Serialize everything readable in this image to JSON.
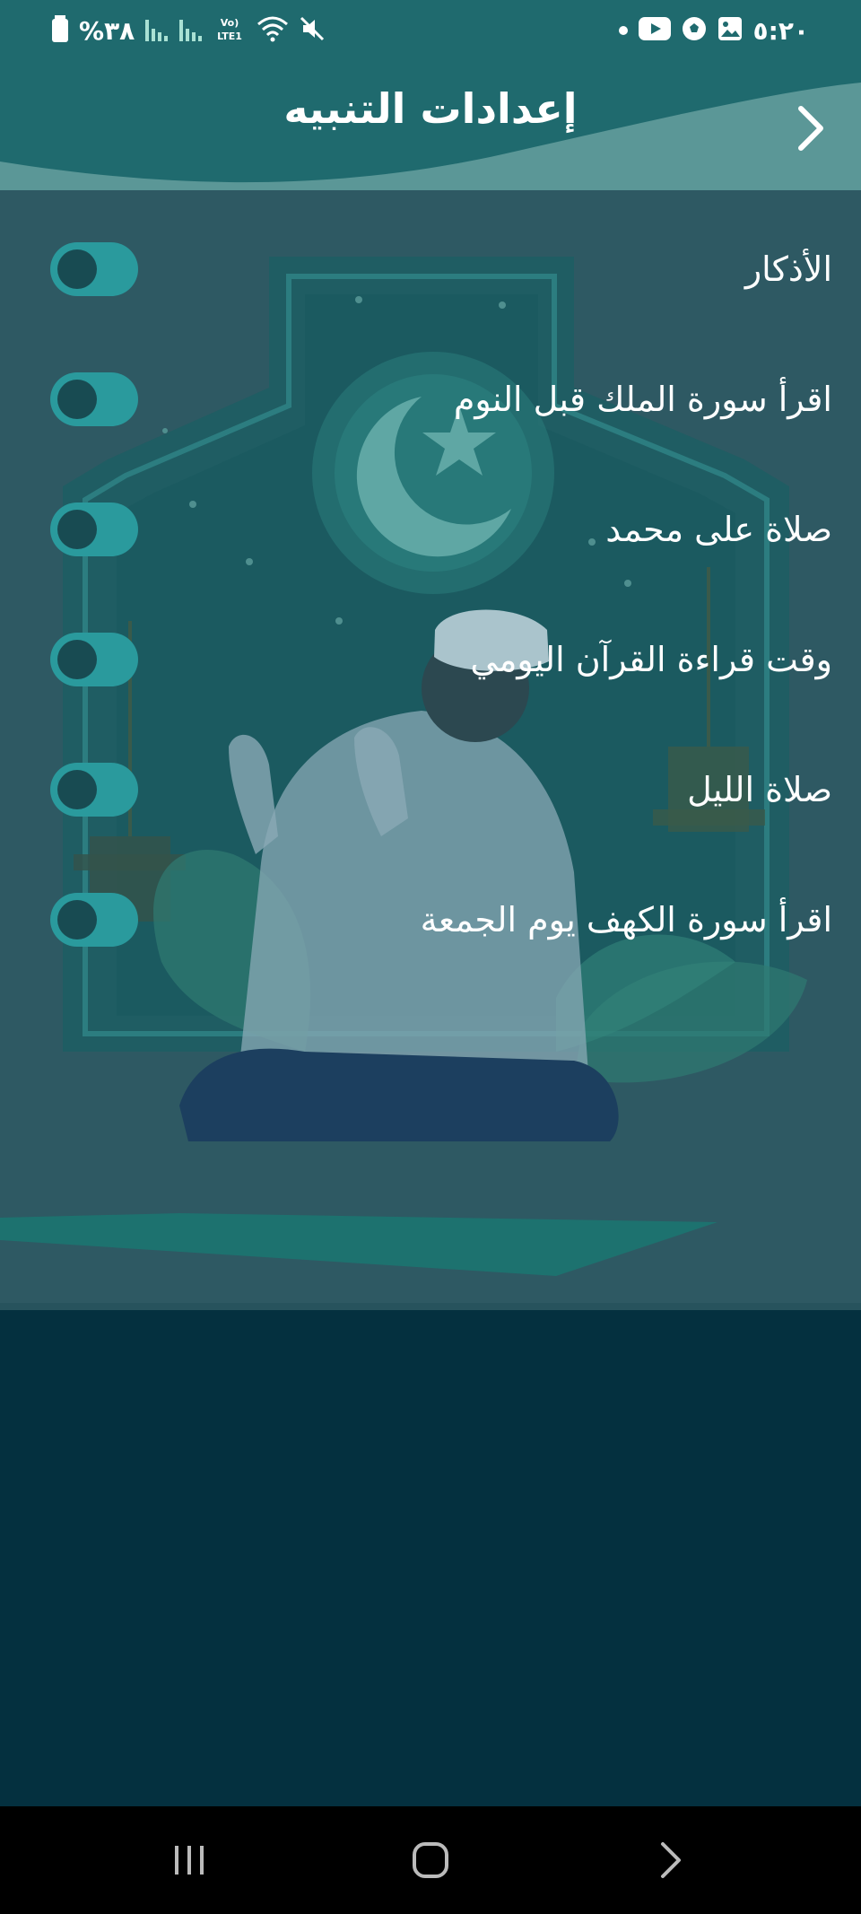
{
  "status_bar": {
    "time": "٥:٢٠",
    "battery_text": "%٣٨",
    "network_label": "Vo) LTE1",
    "icons_left": [
      "battery-icon",
      "signal-icon",
      "signal-icon",
      "lte-icon",
      "wifi-icon",
      "mute-icon"
    ],
    "icons_right": [
      "notification-dot-icon",
      "youtube-icon",
      "football-icon",
      "gallery-icon"
    ]
  },
  "header": {
    "title": "إعدادات التنبيه",
    "back_icon": "chevron-right-icon"
  },
  "settings": [
    {
      "label": "الأذكار",
      "enabled": false
    },
    {
      "label": "اقرأ سورة الملك قبل النوم",
      "enabled": false
    },
    {
      "label": "صلاة على محمد",
      "enabled": false
    },
    {
      "label": "وقت قراءة القرآن اليومي",
      "enabled": false
    },
    {
      "label": "صلاة الليل",
      "enabled": false
    },
    {
      "label": "اقرأ سورة الكهف يوم الجمعة",
      "enabled": false
    }
  ],
  "nav_bar": {
    "recent_icon": "recent-apps-icon",
    "home_icon": "home-icon",
    "back_icon": "back-icon"
  },
  "colors": {
    "header": "#1f6a6e",
    "content_bg": "#2e5963",
    "page_bg": "#04303f",
    "toggle_track": "#2a9a9d",
    "toggle_knob": "#184b52"
  }
}
